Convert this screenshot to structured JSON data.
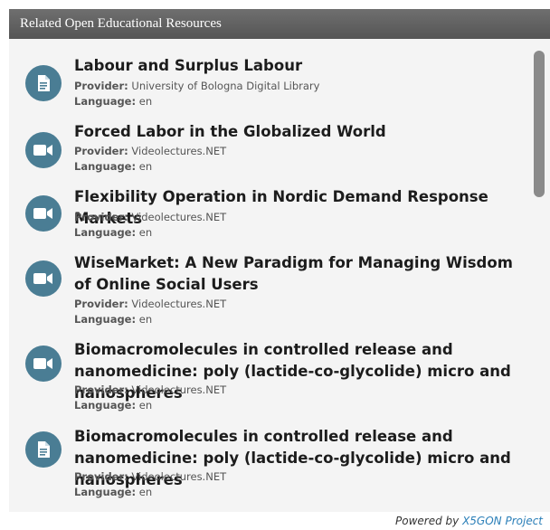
{
  "header": {
    "title": "Related Open Educational Resources"
  },
  "labels": {
    "provider": "Provider:",
    "language": "Language:"
  },
  "items": [
    {
      "icon": "document-icon",
      "title": "Labour and Surplus Labour",
      "provider": "University of Bologna Digital Library",
      "language": "en"
    },
    {
      "icon": "video-icon",
      "title": "Forced Labor in the Globalized World",
      "provider": "Videolectures.NET",
      "language": "en"
    },
    {
      "icon": "video-icon",
      "title": "Flexibility Operation in Nordic Demand Response Markets",
      "provider": "Videolectures.NET",
      "language": "en"
    },
    {
      "icon": "video-icon",
      "title": "WiseMarket: A New Paradigm for Managing Wisdom of Online Social Users",
      "provider": "Videolectures.NET",
      "language": "en"
    },
    {
      "icon": "video-icon",
      "title": "Biomacromolecules in controlled release and nanomedicine: poly (lactide-co-glycolide) micro and nanospheres",
      "provider": "Videolectures.NET",
      "language": "en"
    },
    {
      "icon": "document-icon",
      "title": "Biomacromolecules in controlled release and nanomedicine: poly (lactide-co-glycolide) micro and nanospheres",
      "provider": "Videolectures.NET",
      "language": "en"
    }
  ],
  "footer": {
    "prefix": "Powered by ",
    "link": "X5GON Project"
  },
  "colors": {
    "icon_bg": "#4a7d94",
    "link": "#2b7fb8",
    "header_bg": "#5f5f5f",
    "panel_bg": "#f4f4f4"
  }
}
